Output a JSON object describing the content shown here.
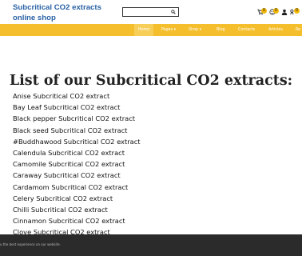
{
  "header": {
    "site_title": "Subcritical CO2 extracts online shop",
    "search_placeholder": "",
    "cart_count": "0"
  },
  "nav": {
    "items": [
      {
        "label": "Home"
      },
      {
        "label": "Pages ▾"
      },
      {
        "label": "Shop ▾"
      },
      {
        "label": "Blog"
      },
      {
        "label": "Contacts"
      },
      {
        "label": "Articles"
      },
      {
        "label": "Re"
      }
    ]
  },
  "main": {
    "heading": "List of our Subcritical CO2 extracts:",
    "extracts": [
      "Anise Subcritical CO2 extract",
      "Bay Leaf Subcritical CO2 extract",
      "Black pepper Subcritical CO2 extract",
      "Black seed Subcritical CO2 extract",
      "#Buddhawood Subcritical CO2 extract",
      "Calendula Subcritical CO2 extract",
      "Camomile Subcritical CO2 extract",
      "Caraway Subcritical CO2 extract",
      "Cardamom Subcritical CO2 extract",
      "Celery Subcritical CO2 extract",
      "Chilli Subcritical CO2 extract",
      "Cinnamon Subcritical CO2 extract",
      "Clove Subcritical CO2 extract"
    ]
  },
  "cookie": {
    "text": "u the best experience on our website."
  },
  "colors": {
    "nav_bg": "#f4be2c",
    "title_blue": "#2a62a6",
    "badge": "#f2b705",
    "cookie_bg": "#2b2b2b"
  }
}
